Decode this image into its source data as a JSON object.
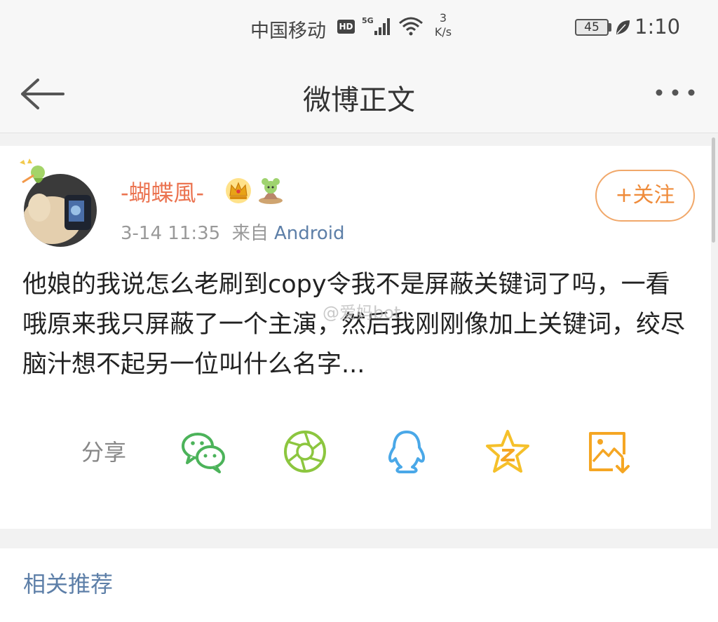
{
  "status_bar": {
    "carrier": "中国移动",
    "hd": "HD",
    "network": "5G",
    "speed_value": "3",
    "speed_unit": "K/s",
    "battery": "45",
    "time": "1:10"
  },
  "nav": {
    "title": "微博正文"
  },
  "post": {
    "username": "-蝴蝶風-",
    "time": "3-14 11:35",
    "source_prefix": "来自",
    "source": "Android",
    "follow_label": "+关注",
    "text": "他娘的我说怎么老刷到copy令我不是屏蔽关键词了吗，一看哦原来我只屏蔽了一个主演，然后我刚刚像加上关键词，绞尽脑汁想不起另一位叫什么名字...",
    "watermark": "@爱妈bot"
  },
  "share": {
    "label": "分享",
    "targets": [
      "wechat-icon",
      "moments-icon",
      "qq-icon",
      "qzone-icon",
      "save-image-icon"
    ]
  },
  "related": {
    "title": "相关推荐"
  },
  "colors": {
    "accent_orange": "#eb7350",
    "link_blue": "#5d7fa8",
    "wechat_green": "#4cb35a",
    "moments_green": "#8cc63f",
    "qq_blue": "#4aa8e8",
    "qzone_yellow": "#f5c02a"
  }
}
